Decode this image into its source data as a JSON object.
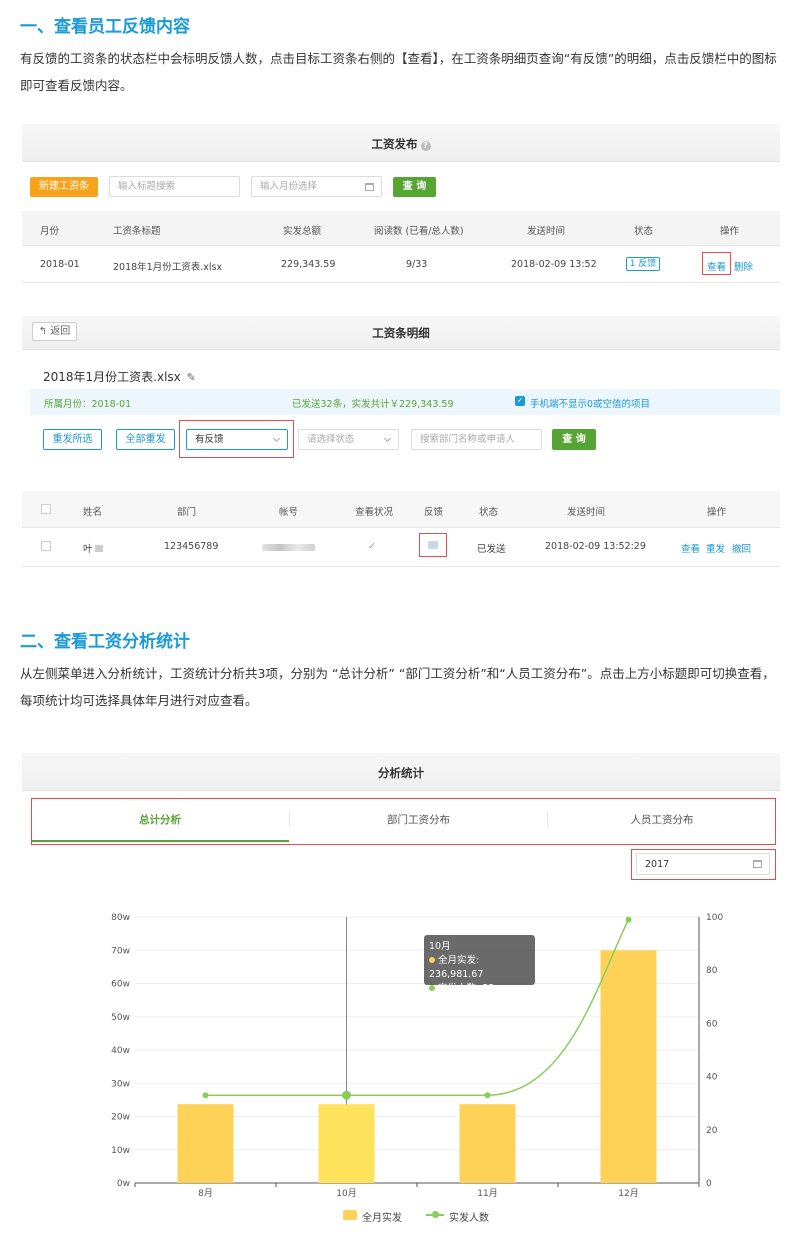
{
  "section1": {
    "title": "一、查看员工反馈内容",
    "para": "有反馈的工资条的状态栏中会标明反馈人数，点击目标工资条右侧的【查看】，在工资条明细页查询“有反馈”的明细，点击反馈栏中的图标即可查看反馈内容。"
  },
  "publish": {
    "title": "工资发布",
    "help_icon": "question-circle-icon",
    "new_button": "新建工资条",
    "search_placeholder": "输入标题搜索",
    "month_placeholder": "输入月份选择",
    "query_button": "查 询",
    "columns": [
      "月份",
      "工资条标题",
      "实发总额",
      "阅读数 (已看/总人数)",
      "发送时间",
      "状态",
      "操作"
    ],
    "row": {
      "month": "2018-01",
      "title": "2018年1月份工资表.xlsx",
      "total": "229,343.59",
      "reads": "9/33",
      "time": "2018-02-09 13:52",
      "status": "1 反馈",
      "view": "查看",
      "delete": "删除"
    }
  },
  "detail": {
    "back_button": "返回",
    "title": "工资条明细",
    "file_title": "2018年1月份工资表.xlsx",
    "edit_icon": "pencil-icon",
    "month_label": "所属月份：2018-01",
    "sent_info": "已发送32条，实发共计￥229,343.59",
    "hide_zero_label": "手机端不显示0或空值的项目",
    "resend_selected": "重发所选",
    "resend_all": "全部重发",
    "feedback_filter": "有反馈",
    "status_placeholder": "请选择状态",
    "search_placeholder": "搜索部门名称或申请人",
    "query_button": "查 询",
    "columns": [
      "姓名",
      "部门",
      "帐号",
      "查看状况",
      "反馈",
      "状态",
      "发送时间",
      "操作"
    ],
    "row": {
      "name": "叶",
      "dept": "123456789",
      "viewed": "✓",
      "status": "已发送",
      "time": "2018-02-09 13:52:29",
      "view": "查看",
      "resend": "重发",
      "revoke": "撤回"
    }
  },
  "section2": {
    "title": "二、查看工资分析统计",
    "para": "从左侧菜单进入分析统计，工资统计分析共3项，分别为 “总计分析” “部门工资分析”和“人员工资分布”。点击上方小标题即可切换查看，每项统计均可选择具体年月进行对应查看。"
  },
  "analysis": {
    "title": "分析统计",
    "tabs": [
      "总计分析",
      "部门工资分布",
      "人员工资分布"
    ],
    "active_tab": 0,
    "year": "2017",
    "tooltip": {
      "title": "10月",
      "line1": "全月实发: 236,981.67",
      "line2": "实发人数: 33"
    },
    "colors": {
      "bar": "#fdd257",
      "bar_active": "#ffe25c",
      "line": "#8ccc5a",
      "accent": "#1a9ad6"
    }
  },
  "chart_data": {
    "type": "bar",
    "categories": [
      "8月",
      "10月",
      "11月",
      "12月"
    ],
    "series": [
      {
        "name": "全月实发",
        "type": "bar",
        "axis": "left",
        "values": [
          236981.67,
          236981.67,
          236981.67,
          700000
        ]
      },
      {
        "name": "实发人数",
        "type": "line",
        "axis": "right",
        "values": [
          33,
          33,
          33,
          99
        ]
      }
    ],
    "y_left": {
      "ticks": [
        "0w",
        "10w",
        "20w",
        "30w",
        "40w",
        "50w",
        "60w",
        "70w",
        "80w"
      ],
      "lim": [
        0,
        800000
      ]
    },
    "y_right": {
      "ticks": [
        "0",
        "20",
        "40",
        "60",
        "80",
        "100"
      ],
      "lim": [
        0,
        100
      ]
    },
    "legend_position": "bottom-center",
    "grid": true
  }
}
